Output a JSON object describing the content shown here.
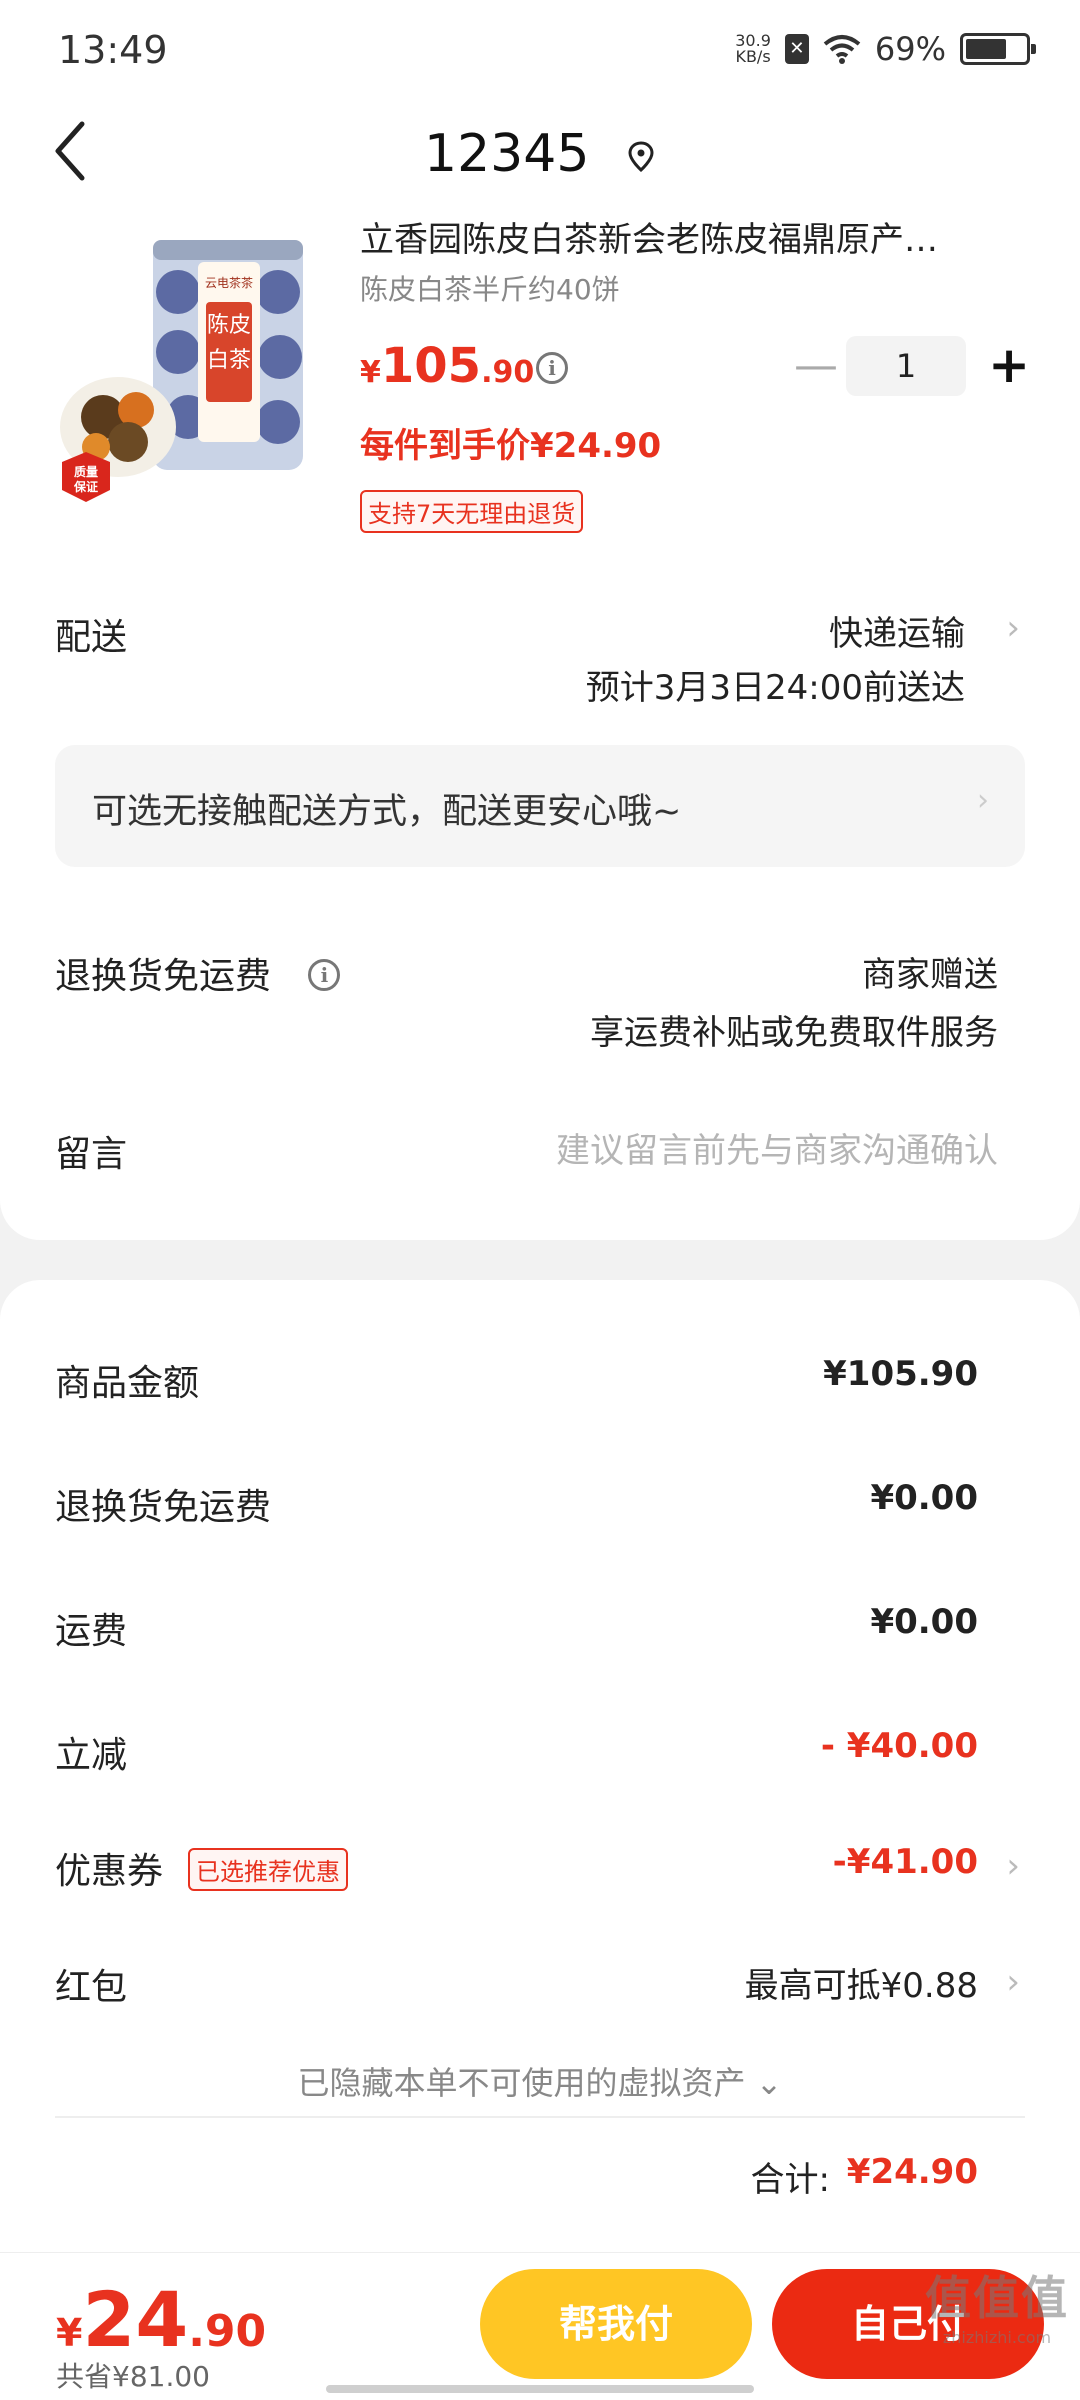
{
  "status_bar": {
    "time": "13:49",
    "net_speed_value": "30.9",
    "net_speed_unit": "KB/s",
    "battery_pct": "69%",
    "battery_level": 0.69
  },
  "nav": {
    "title": "12345"
  },
  "product": {
    "title": "立香园陈皮白茶新会老陈皮福鼎原产…",
    "spec": "陈皮白茶半斤约40饼",
    "price_symbol": "¥",
    "price_int": "105",
    "price_dec": ".90",
    "quantity": "1",
    "per_item_price": "每件到手价¥24.90",
    "return_tag": "支持7天无理由退货",
    "image_brand": "云电茶茶",
    "image_name": "陈皮白茶",
    "image_badge": "质量保证"
  },
  "delivery": {
    "label": "配送",
    "method": "快递运输",
    "eta": "预计3月3日24:00前送达"
  },
  "notice": {
    "text": "可选无接触配送方式，配送更安心哦~"
  },
  "return_shipping": {
    "label": "退换货免运费",
    "value": "商家赠送",
    "desc": "享运费补贴或免费取件服务"
  },
  "message": {
    "label": "留言",
    "placeholder": "建议留言前先与商家沟通确认"
  },
  "summary": {
    "goods_label": "商品金额",
    "goods_value": "¥105.90",
    "return_fee_label": "退换货免运费",
    "return_fee_value": "¥0.00",
    "shipping_label": "运费",
    "shipping_value": "¥0.00",
    "discount_label": "立减",
    "discount_value": "- ¥40.00",
    "coupon_label": "优惠券",
    "coupon_tag": "已选推荐优惠",
    "coupon_value": "-¥41.00",
    "redpacket_label": "红包",
    "redpacket_value": "最高可抵¥0.88",
    "hidden_note": "已隐藏本单不可使用的虚拟资产 ⌄",
    "total_label": "合计:",
    "total_value": "¥24.90"
  },
  "bottom_bar": {
    "price_symbol": "¥",
    "price_int": "24",
    "price_dec": ".90",
    "saved": "共省¥81.00",
    "help_pay": "帮我付",
    "self_pay": "自己付"
  },
  "watermark": {
    "big": "值值值",
    "small": "zhizhizhi.com"
  },
  "colors": {
    "accent_red": "#e8321f",
    "help_yellow": "#ffc624",
    "self_red": "#eb2a12"
  }
}
